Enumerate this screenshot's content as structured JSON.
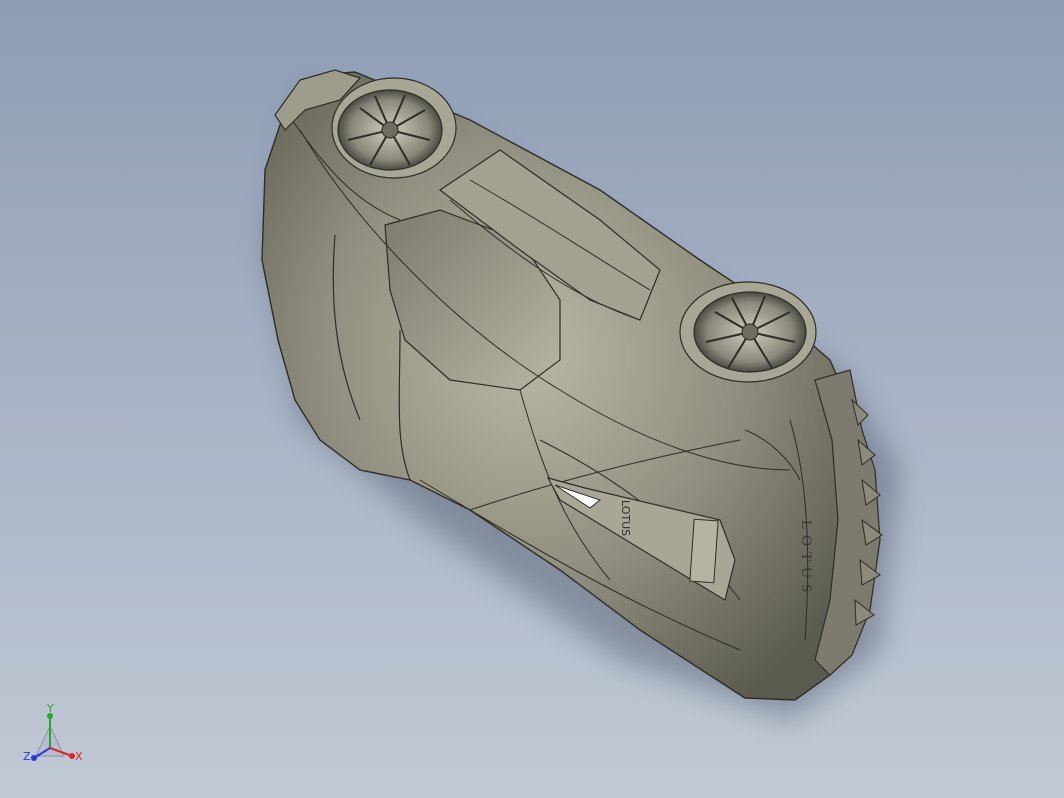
{
  "viewport": {
    "background_top": "#8e9db5",
    "background_bottom": "#c2c9d5",
    "model_color": "#8f8d7d"
  },
  "model": {
    "hood_badge": "LOTUS",
    "rear_lettering": "LOTUS"
  },
  "triad": {
    "x_label": "X",
    "y_label": "Y",
    "z_label": "Z",
    "x_color": "#d8262a",
    "y_color": "#29a529",
    "z_color": "#2a3ad8"
  }
}
